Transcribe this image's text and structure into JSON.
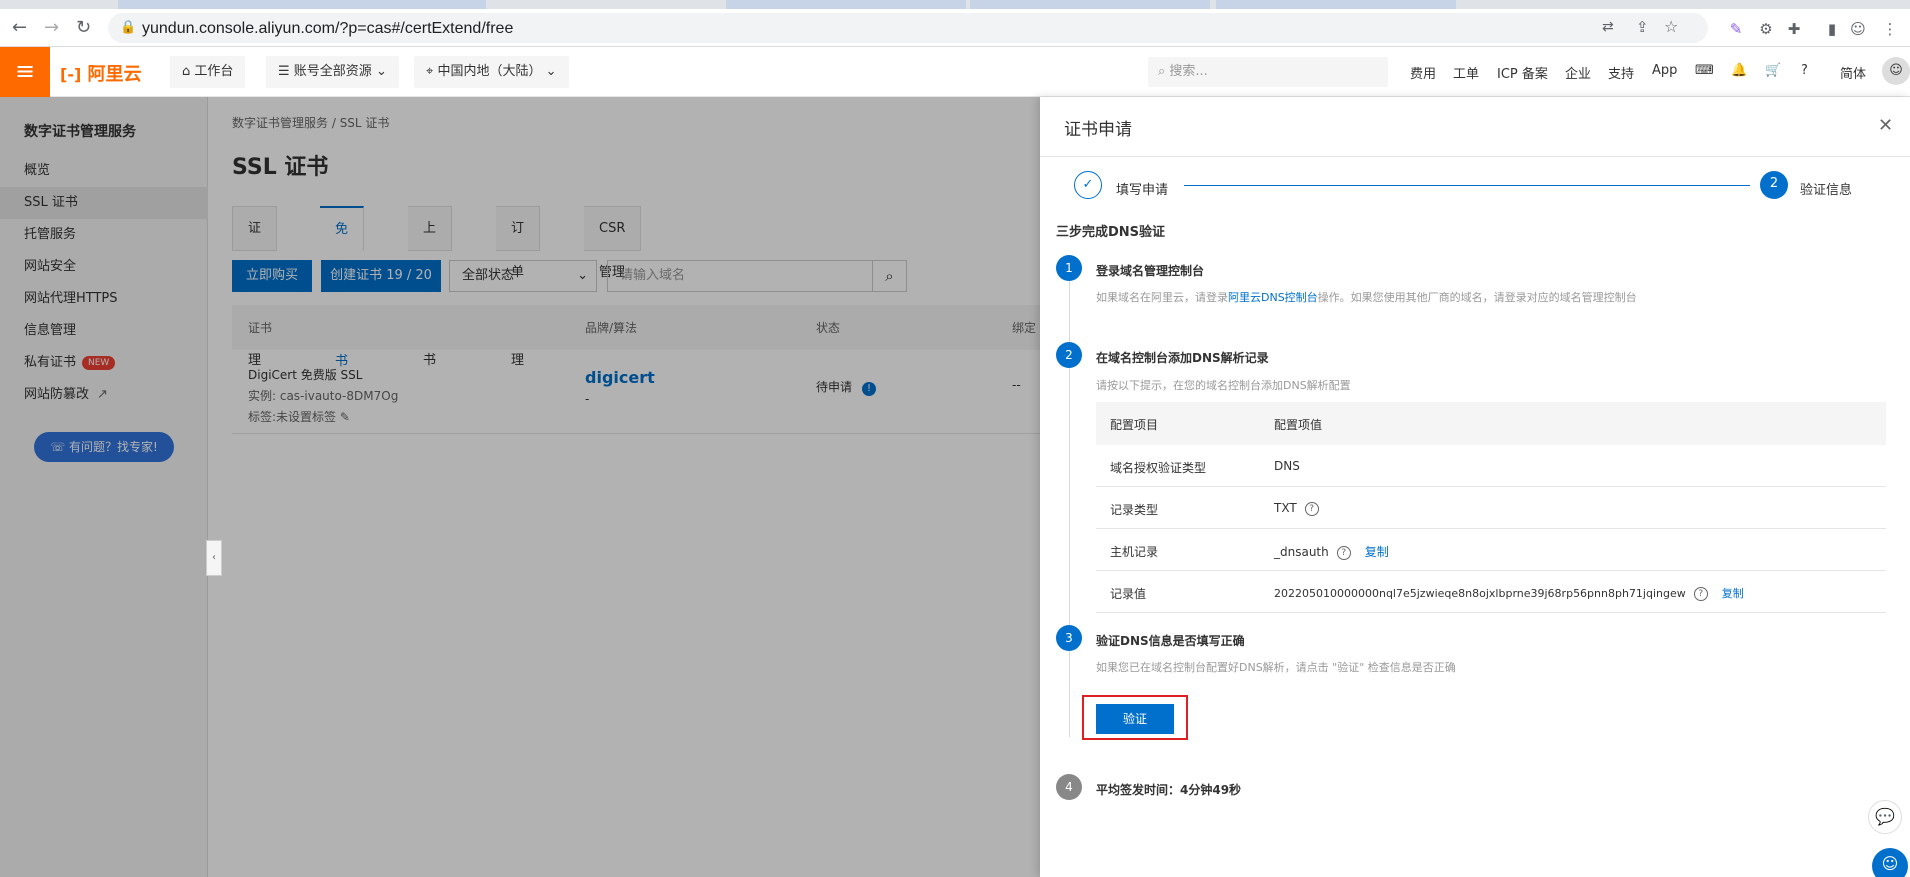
{
  "browser": {
    "url": "yundun.console.aliyun.com/?p=cas#/certExtend/free"
  },
  "header": {
    "logo_text": "阿里云",
    "workbench": "工作台",
    "resources": "账号全部资源",
    "region": "中国内地（大陆）",
    "search_placeholder": "搜索...",
    "links": [
      "费用",
      "工单",
      "ICP 备案",
      "企业",
      "支持",
      "App"
    ],
    "lang": "简体"
  },
  "sidebar": {
    "title": "数字证书管理服务",
    "items": [
      {
        "label": "概览"
      },
      {
        "label": "SSL 证书"
      },
      {
        "label": "托管服务"
      },
      {
        "label": "网站安全"
      },
      {
        "label": "网站代理HTTPS"
      },
      {
        "label": "信息管理"
      },
      {
        "label": "私有证书",
        "badge": "NEW"
      },
      {
        "label": "网站防篡改"
      }
    ],
    "help_button": "有问题？找专家!"
  },
  "main": {
    "breadcrumb_root": "数字证书管理服务",
    "breadcrumb_current": "SSL 证书",
    "title": "SSL 证书",
    "tabs": [
      "证书管理",
      "免费证书",
      "上传证书",
      "订单管理",
      "CSR管理"
    ],
    "buy_button": "立即购买",
    "create_button": "创建证书 19 / 20",
    "status_select": "全部状态",
    "domain_placeholder": "请输入域名",
    "columns": [
      "证书",
      "品牌/算法",
      "状态",
      "绑定"
    ],
    "row": {
      "name": "DigiCert 免费版 SSL",
      "instance": "实例: cas-ivauto-8DM7Og",
      "tag": "标签:未设置标签",
      "brand": "digicert",
      "algo": "-",
      "status": "待申请",
      "bind": "--"
    }
  },
  "drawer": {
    "title": "证书申请",
    "step1": "填写申请",
    "step2_num": "2",
    "step2": "验证信息",
    "dns_title": "三步完成DNS验证",
    "s1_num": "1",
    "s1_title": "登录域名管理控制台",
    "s1_desc_a": "如果域名在阿里云，请登录",
    "s1_link": "阿里云DNS控制台",
    "s1_desc_b": "操作。如果您使用其他厂商的域名，请登录对应的域名管理控制台",
    "s2_num": "2",
    "s2_title": "在域名控制台添加DNS解析记录",
    "s2_desc": "请按以下提示，在您的域名控制台添加DNS解析配置",
    "table_head": [
      "配置项目",
      "配置项值"
    ],
    "rows": [
      {
        "k": "域名授权验证类型",
        "v": "DNS"
      },
      {
        "k": "记录类型",
        "v": "TXT"
      },
      {
        "k": "主机记录",
        "v": "_dnsauth"
      },
      {
        "k": "记录值",
        "v": "202205010000000nql7e5jzwieqe8n8ojxlbprne39j68rp56pnn8ph71jqingew"
      }
    ],
    "copy": "复制",
    "s3_num": "3",
    "s3_title": "验证DNS信息是否填写正确",
    "s3_desc": "如果您已在域名控制台配置好DNS解析，请点击 \"验证\" 检查信息是否正确",
    "verify_button": "验证",
    "s4_num": "4",
    "s4_title": "平均签发时间：4分钟49秒"
  },
  "colors": {
    "brand": "#ff6a00",
    "primary": "#0070cc",
    "highlight": "#e02020"
  }
}
